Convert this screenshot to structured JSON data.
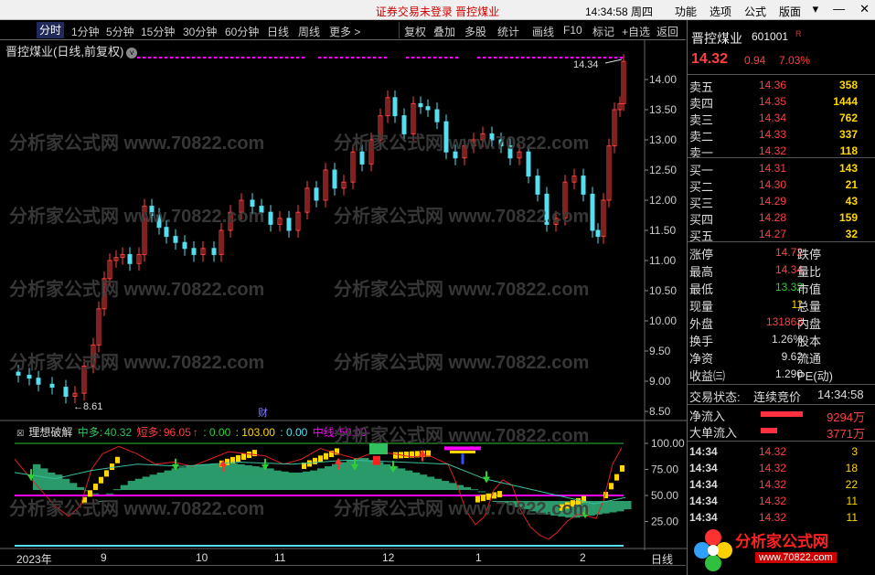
{
  "titlebar": {
    "center_text": "证券交易未登录  晋控煤业",
    "time": "14:34:58 周四",
    "menus": [
      "功能",
      "选项",
      "公式",
      "版面"
    ],
    "win_buttons": [
      "▾",
      "—",
      "✕"
    ]
  },
  "toolbar": {
    "tabs": [
      "分时",
      "1分钟",
      "5分钟",
      "15分钟",
      "30分钟",
      "60分钟",
      "日线",
      "周线",
      "更多 >"
    ],
    "active_tab": "分时",
    "right_tabs": [
      "复权",
      "叠加",
      "多股",
      "统计",
      "画线",
      "F10",
      "标记",
      "+自选",
      "返回"
    ]
  },
  "stock_header": {
    "title": "晋控煤业(日线,前复权)"
  },
  "price_axis": [
    "14.00",
    "13.50",
    "13.00",
    "12.50",
    "12.00",
    "11.50",
    "11.00",
    "10.50",
    "10.00",
    "9.50",
    "9.00",
    "8.50"
  ],
  "annotations": {
    "high": "14.34",
    "low": "8.61",
    "fin_mark": "财"
  },
  "indicator": {
    "name": "理想破解",
    "zd_label": "中多:",
    "zd_value": "40.32",
    "dd_label": "短多:",
    "dd_value": "96.05",
    "v1": ": 0.00",
    "v2": ": 103.00",
    "v3": ": 0.00",
    "zx_label": "中线:",
    "zx_value": "50.00",
    "axis": [
      "100.00",
      "75.00",
      "50.00",
      "25.00"
    ]
  },
  "x_axis": {
    "labels": [
      "2023年",
      "9",
      "10",
      "11",
      "12",
      "1",
      "2"
    ],
    "right_tab": "日线"
  },
  "quote": {
    "name": "晋控煤业",
    "code": "601001",
    "flag": "R",
    "price": "14.32",
    "change": "0.94",
    "pct": "7.03%",
    "asks": [
      {
        "label": "卖五",
        "price": "14.36",
        "vol": "358"
      },
      {
        "label": "卖四",
        "price": "14.35",
        "vol": "1444"
      },
      {
        "label": "卖三",
        "price": "14.34",
        "vol": "762"
      },
      {
        "label": "卖二",
        "price": "14.33",
        "vol": "337"
      },
      {
        "label": "卖一",
        "price": "14.32",
        "vol": "118"
      }
    ],
    "bids": [
      {
        "label": "买一",
        "price": "14.31",
        "vol": "143"
      },
      {
        "label": "买二",
        "price": "14.30",
        "vol": "21"
      },
      {
        "label": "买三",
        "price": "14.29",
        "vol": "43"
      },
      {
        "label": "买四",
        "price": "14.28",
        "vol": "159"
      },
      {
        "label": "买五",
        "price": "14.27",
        "vol": "32"
      }
    ],
    "stats": [
      {
        "label": "涨停",
        "value": "14.72",
        "color": "#ff4040",
        "label2": "跌停"
      },
      {
        "label": "最高",
        "value": "14.34",
        "color": "#ff4040",
        "label2": "量比"
      },
      {
        "label": "最低",
        "value": "13.32",
        "color": "#30d030",
        "label2": "市值"
      },
      {
        "label": "现量",
        "value": "11",
        "color": "#ffd700",
        "label2": "总量"
      },
      {
        "label": "外盘",
        "value": "131863",
        "color": "#ff4040",
        "label2": "内盘"
      },
      {
        "label": "换手",
        "value": "1.26%",
        "color": "#dddddd",
        "label2": "股本"
      },
      {
        "label": "净资",
        "value": "9.62",
        "color": "#dddddd",
        "label2": "流通"
      },
      {
        "label": "收益㈢",
        "value": "1.290",
        "color": "#dddddd",
        "label2": "PE(动)"
      }
    ],
    "status_label": "交易状态:",
    "status_value": "连续竞价",
    "status_time": "14:34:58",
    "net_inflow_label": "净流入",
    "net_inflow_value": "9294万",
    "big_inflow_label": "大单流入",
    "big_inflow_value": "3771万",
    "ticks": [
      {
        "t": "14:34",
        "p": "14.32",
        "v": "3"
      },
      {
        "t": "14:34",
        "p": "14.32",
        "v": "18"
      },
      {
        "t": "14:34",
        "p": "14.32",
        "v": "22"
      },
      {
        "t": "14:34",
        "p": "14.32",
        "v": "11"
      },
      {
        "t": "14:34",
        "p": "14.32",
        "v": "11"
      }
    ]
  },
  "logo": {
    "text": "分析家公式网",
    "url": "www.70822.com"
  },
  "watermark": "分析家公式网 www.70822.com",
  "colors": {
    "up": "#ff4040",
    "down": "#54e0f0",
    "accent": "#ff00ff",
    "yellow": "#ffd700",
    "green": "#30c060"
  }
}
